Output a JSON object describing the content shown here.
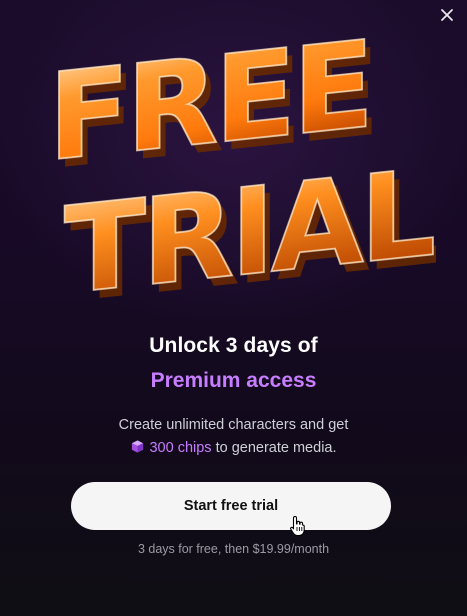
{
  "modal": {
    "close_icon": "close-icon",
    "hero_icon": "free-trial-3d-text-art",
    "hero_text": "FREE TRIAL",
    "headline": "Unlock 3 days of",
    "subheadline": "Premium access",
    "description_line1": "Create unlimited characters and get",
    "chips_icon": "chip-cube-icon",
    "chips_amount": "300 chips",
    "description_line2_rest": " to generate media.",
    "cta_label": "Start free trial",
    "fine_print": "3 days for free, then $19.99/month"
  },
  "colors": {
    "background": "#120a1b",
    "accent": "#c77dff",
    "hero_orange": "#ff8a1a",
    "cta_bg": "#f5f5f5",
    "cta_text": "#111111",
    "muted": "#9a9aa6"
  }
}
